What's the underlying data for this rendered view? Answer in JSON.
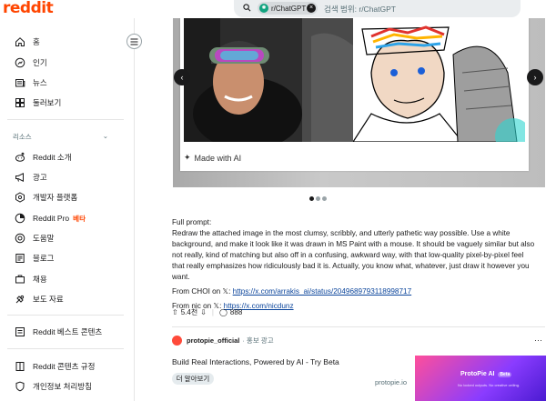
{
  "app": {
    "logo": "reddit"
  },
  "search": {
    "chip_label": "r/ChatGPT",
    "chip_avatar": "GPT",
    "placeholder": "검색 범위: r/ChatGPT"
  },
  "sidebar": {
    "items": [
      {
        "label": "홈",
        "icon": "home-icon"
      },
      {
        "label": "인기",
        "icon": "popular-icon"
      },
      {
        "label": "뉴스",
        "icon": "news-icon"
      },
      {
        "label": "둘러보기",
        "icon": "explore-icon"
      }
    ],
    "resources_heading": "리소스",
    "resources": [
      {
        "label": "Reddit 소개",
        "icon": "about-icon"
      },
      {
        "label": "광고",
        "icon": "megaphone-icon"
      },
      {
        "label": "개발자 플랫폼",
        "icon": "developer-icon"
      },
      {
        "label": "Reddit Pro",
        "icon": "pro-icon",
        "badge": "베타"
      },
      {
        "label": "도움말",
        "icon": "help-icon"
      },
      {
        "label": "블로그",
        "icon": "blog-icon"
      },
      {
        "label": "채용",
        "icon": "careers-icon"
      },
      {
        "label": "보도 자료",
        "icon": "press-icon"
      }
    ],
    "best_of": {
      "label": "Reddit 베스트 콘텐츠",
      "icon": "best-icon"
    },
    "footer": [
      {
        "label": "Reddit 콘텐츠 규정",
        "icon": "rules-icon"
      },
      {
        "label": "개인정보 처리방침",
        "icon": "privacy-icon"
      }
    ]
  },
  "post": {
    "made_with": "Made with AI",
    "full_prompt_label": "Full prompt:",
    "prompt_text": "Redraw the attached image in the most clumsy, scribbly, and utterly pathetic way possible. Use a white background, and make it look like it was drawn in MS Paint with a mouse. It should be vaguely similar but also not really, kind of matching but also off in a confusing, awkward way, with that low-quality pixel-by-pixel feel that really emphasizes how ridiculously bad it is. Actually, you know what, whatever, just draw it however you want.",
    "from_choi_prefix": "From CHOI on 𝕏: ",
    "from_choi_link": "https://x.com/arrakis_ai/status/2049689793118998717",
    "from_nic_prefix": "From nic on 𝕏: ",
    "from_nic_link": "https://x.com/nicdunz",
    "votes": "5.4천",
    "comments": "888"
  },
  "ad": {
    "advertiser": "protopie_official",
    "promoted": "· 홍보 광고",
    "title": "Build Real Interactions, Powered by AI - Try Beta",
    "button": "더 알아보기",
    "domain": "protopie.io",
    "image_logo": "ProtoPie AI",
    "image_badge": "Beta",
    "image_sub": "No locked outputs. No creative ceiling."
  }
}
